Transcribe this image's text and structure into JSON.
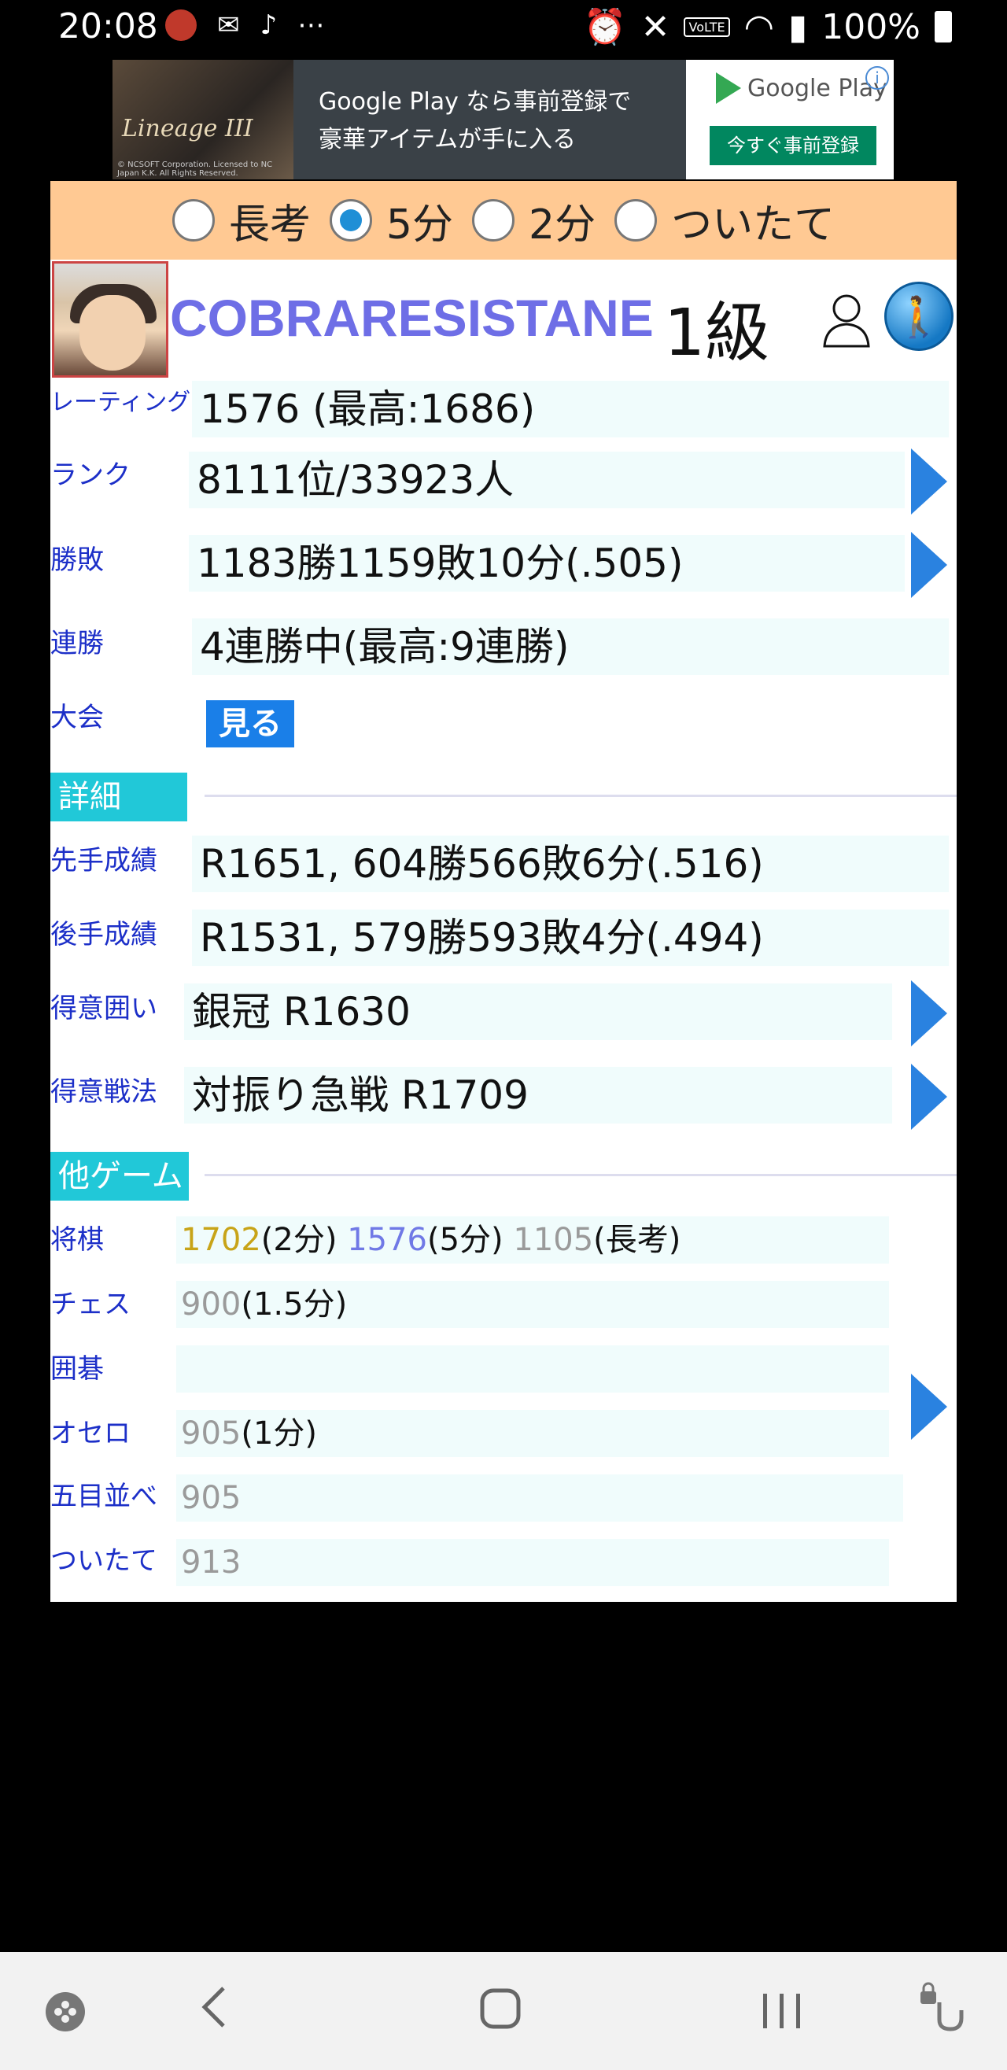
{
  "status_bar": {
    "time": "20:08",
    "battery_text": "100%",
    "volte": "VoLTE"
  },
  "ad": {
    "game_title": "Lineage III",
    "copyright": "© NCSOFT Corporation. Licensed to NC Japan K.K. All Rights Reserved.",
    "line1": "Google Play なら事前登録で",
    "line2": "豪華アイテムが手に入る",
    "store_name": "Google Play",
    "cta": "今すぐ事前登録",
    "info_glyph": "i"
  },
  "mode_options": [
    {
      "label": "長考",
      "checked": false
    },
    {
      "label": "5分",
      "checked": true
    },
    {
      "label": "2分",
      "checked": false
    },
    {
      "label": "ついたて",
      "checked": false
    }
  ],
  "profile": {
    "username": "COBRARESISTANE",
    "rank": "1級"
  },
  "stats": {
    "rating_label": "レーティング",
    "rating_value": "1576 (最高:1686)",
    "rank_label": "ランク",
    "rank_value": "8111位/33923人",
    "record_label": "勝敗",
    "record_value": "1183勝1159敗10分(.505)",
    "streak_label": "連勝",
    "streak_value": "4連勝中(最高:9連勝)",
    "tournament_label": "大会",
    "tournament_button": "見る"
  },
  "details": {
    "section_title": "詳細",
    "sente_label": "先手成績",
    "sente_value": "R1651, 604勝566敗6分(.516)",
    "gote_label": "後手成績",
    "gote_value": "R1531, 579勝593敗4分(.494)",
    "castle_label": "得意囲い",
    "castle_value": "銀冠 R1630",
    "strategy_label": "得意戦法",
    "strategy_value": "対振り急戦 R1709"
  },
  "other_games": {
    "section_title": "他ゲーム",
    "shogi_label": "将棋",
    "shogi_r2": "1702",
    "shogi_r2_unit": "(2分)",
    "shogi_r5": "1576",
    "shogi_r5_unit": "(5分)",
    "shogi_long": "1105",
    "shogi_long_unit": "(長考)",
    "chess_label": "チェス",
    "chess_r": "900",
    "chess_unit": "(1.5分)",
    "go_label": "囲碁",
    "othello_label": "オセロ",
    "othello_r": "905",
    "othello_unit": "(1分)",
    "gomoku_label": "五目並べ",
    "gomoku_r": "905",
    "tsuitate_label": "ついたて",
    "tsuitate_r": "913"
  },
  "colors": {
    "mode_bar": "#ffc993",
    "label_blue": "#1c2fc8",
    "username": "#6e6ee6",
    "section_tab": "#21c8d8",
    "arrow": "#2a82e0",
    "rating_2min": "#c8a418",
    "rating_5min": "#7079e6",
    "rating_gray": "#9a9a9a"
  }
}
